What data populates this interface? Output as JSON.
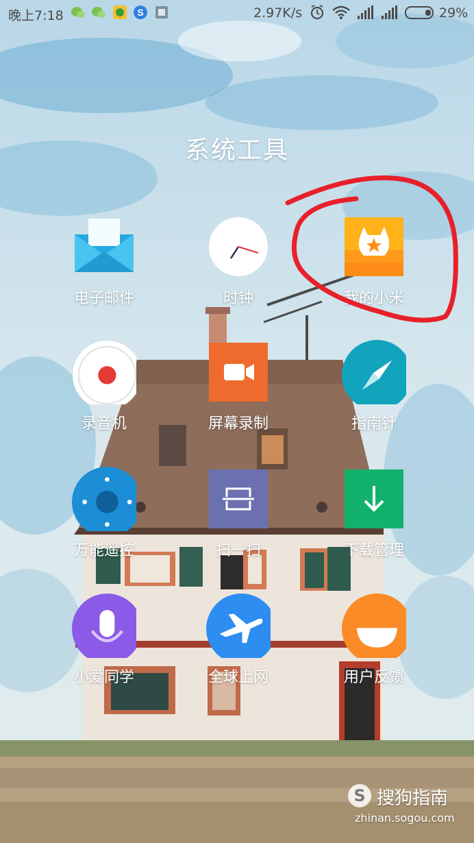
{
  "status_bar": {
    "time": "晚上7:18",
    "net_speed": "2.97K/s",
    "battery_percent": "29%",
    "notification_icons": [
      "wechat-icon",
      "wechat-icon",
      "app-notification-icon",
      "sogou-icon",
      "screenshot-icon"
    ],
    "system_icons": [
      "alarm-icon",
      "wifi-icon",
      "signal-icon",
      "signal-icon",
      "battery-icon"
    ]
  },
  "folder": {
    "title": "系统工具",
    "apps": [
      {
        "label": "电子邮件",
        "icon": "mail-icon",
        "color": "#2bb5e8"
      },
      {
        "label": "时钟",
        "icon": "clock-icon",
        "color": "#ffffff"
      },
      {
        "label": "我的小米",
        "icon": "mi-bunny-icon",
        "color": "#ffa21c"
      },
      {
        "label": "录音机",
        "icon": "record-icon",
        "color": "#e53935"
      },
      {
        "label": "屏幕录制",
        "icon": "video-camera-icon",
        "color": "#f06a2b"
      },
      {
        "label": "指南针",
        "icon": "compass-icon",
        "color": "#16a7bd"
      },
      {
        "label": "万能遥控",
        "icon": "remote-control-icon",
        "color": "#1e8fd6"
      },
      {
        "label": "扫一扫",
        "icon": "scan-icon",
        "color": "#6c72b3"
      },
      {
        "label": "下载管理",
        "icon": "download-icon",
        "color": "#14b36f"
      },
      {
        "label": "小爱同学",
        "icon": "microphone-icon",
        "color": "#8c5be6"
      },
      {
        "label": "全球上网",
        "icon": "airplane-icon",
        "color": "#2d8ef0"
      },
      {
        "label": "用户反馈",
        "icon": "smile-feedback-icon",
        "color": "#fb8b28"
      }
    ]
  },
  "annotation": {
    "color": "#e8202a"
  },
  "watermark": {
    "name": "搜狗指南",
    "url": "zhinan.sogou.com",
    "logo": "S"
  }
}
